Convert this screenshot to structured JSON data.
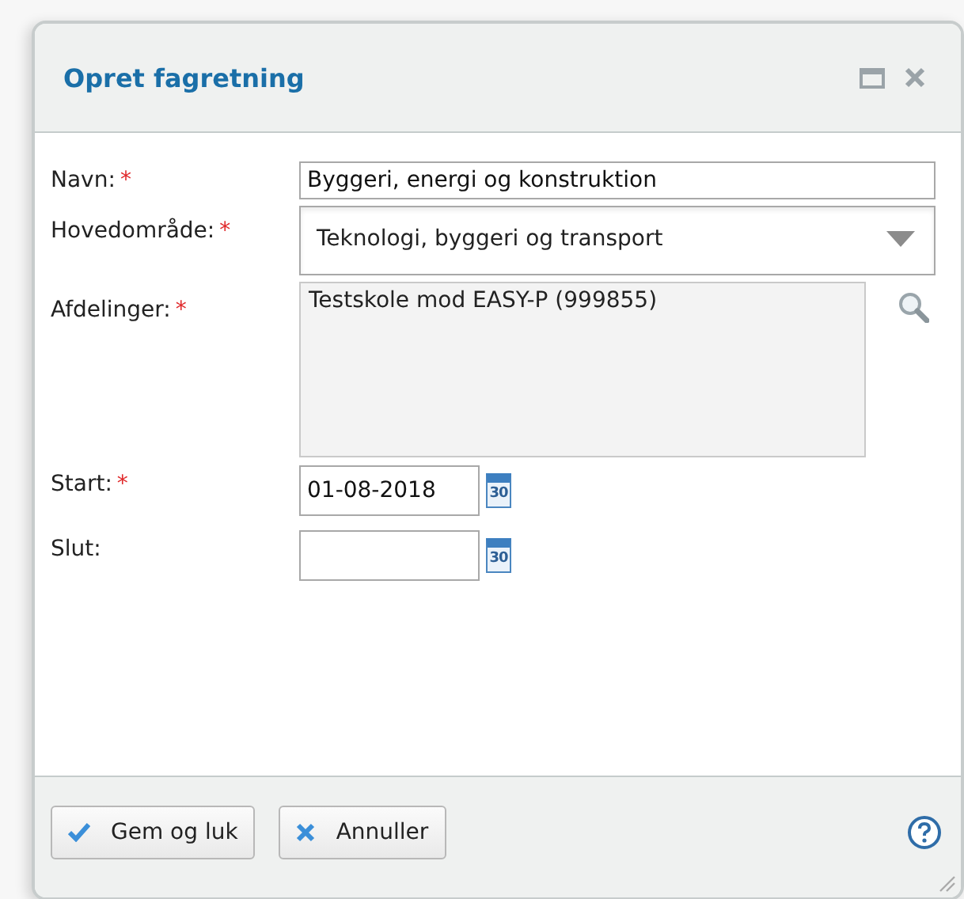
{
  "dialog": {
    "title": "Opret fagretning"
  },
  "fields": [
    {
      "kind": "text",
      "label": "Navn:",
      "mark": "*",
      "value": "Byggeri, energi og konstruktion"
    },
    {
      "kind": "select",
      "label": "Hovedområde:",
      "mark": "*",
      "value": "Teknologi, byggeri og transport"
    },
    {
      "kind": "list",
      "label": "Afdelinger:",
      "mark": "*",
      "value": "Testskole mod EASY-P (999855)"
    },
    {
      "kind": "date",
      "label": "Start:",
      "mark": "*",
      "value": "01-08-2018",
      "icon_text": "30"
    },
    {
      "kind": "date",
      "label": "Slut:",
      "icon_text": "30"
    }
  ],
  "buttons": [
    {
      "kind": "save",
      "label": "Gem og luk"
    },
    {
      "kind": "cancel",
      "label": "Annuller"
    }
  ]
}
